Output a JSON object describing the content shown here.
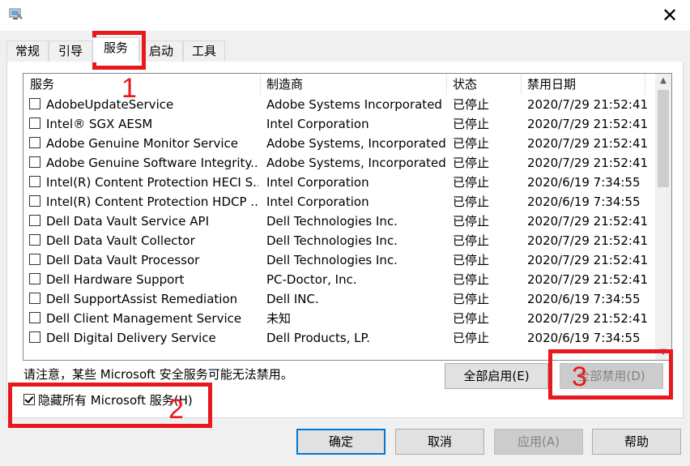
{
  "window": {
    "close_glyph": "✕"
  },
  "tabs": [
    {
      "label": "常规"
    },
    {
      "label": "引导"
    },
    {
      "label": "服务"
    },
    {
      "label": "启动"
    },
    {
      "label": "工具"
    }
  ],
  "columns": [
    "服务",
    "制造商",
    "状态",
    "禁用日期"
  ],
  "rows": [
    {
      "service": "AdobeUpdateService",
      "maker": "Adobe Systems Incorporated",
      "status": "已停止",
      "date": "2020/7/29 21:52:41"
    },
    {
      "service": "Intel® SGX AESM",
      "maker": "Intel Corporation",
      "status": "已停止",
      "date": "2020/7/29 21:52:41"
    },
    {
      "service": "Adobe Genuine Monitor Service",
      "maker": "Adobe Systems, Incorporated",
      "status": "已停止",
      "date": "2020/7/29 21:52:41"
    },
    {
      "service": "Adobe Genuine Software Integrity...",
      "maker": "Adobe Systems, Incorporated",
      "status": "已停止",
      "date": "2020/7/29 21:52:41"
    },
    {
      "service": "Intel(R) Content Protection HECI S...",
      "maker": "Intel Corporation",
      "status": "已停止",
      "date": "2020/6/19 7:34:55"
    },
    {
      "service": "Intel(R) Content Protection HDCP ...",
      "maker": "Intel Corporation",
      "status": "已停止",
      "date": "2020/6/19 7:34:55"
    },
    {
      "service": "Dell Data Vault Service API",
      "maker": "Dell Technologies Inc.",
      "status": "已停止",
      "date": "2020/7/29 21:52:41"
    },
    {
      "service": "Dell Data Vault Collector",
      "maker": "Dell Technologies Inc.",
      "status": "已停止",
      "date": "2020/7/29 21:52:41"
    },
    {
      "service": "Dell Data Vault Processor",
      "maker": "Dell Technologies Inc.",
      "status": "已停止",
      "date": "2020/7/29 21:52:41"
    },
    {
      "service": "Dell Hardware Support",
      "maker": "PC-Doctor, Inc.",
      "status": "已停止",
      "date": "2020/7/29 21:52:41"
    },
    {
      "service": "Dell SupportAssist Remediation",
      "maker": "Dell INC.",
      "status": "已停止",
      "date": "2020/6/19 7:34:55"
    },
    {
      "service": "Dell Client Management Service",
      "maker": "未知",
      "status": "已停止",
      "date": "2020/7/29 21:52:41"
    },
    {
      "service": "Dell Digital Delivery Service",
      "maker": "Dell Products, LP.",
      "status": "已停止",
      "date": "2020/6/19 7:34:55"
    }
  ],
  "note": "请注意，某些 Microsoft 安全服务可能无法禁用。",
  "enable_all_label": "全部启用(E)",
  "disable_all_label": "全部禁用(D)",
  "hide_ms_label": "隐藏所有 Microsoft 服务(H)",
  "hide_ms_checked": true,
  "footer": {
    "ok": "确定",
    "cancel": "取消",
    "apply": "应用(A)",
    "help": "帮助"
  },
  "annotations": [
    "1",
    "2",
    "3"
  ],
  "colors": {
    "annotation": "#e8191e",
    "focus": "#0078d7"
  }
}
